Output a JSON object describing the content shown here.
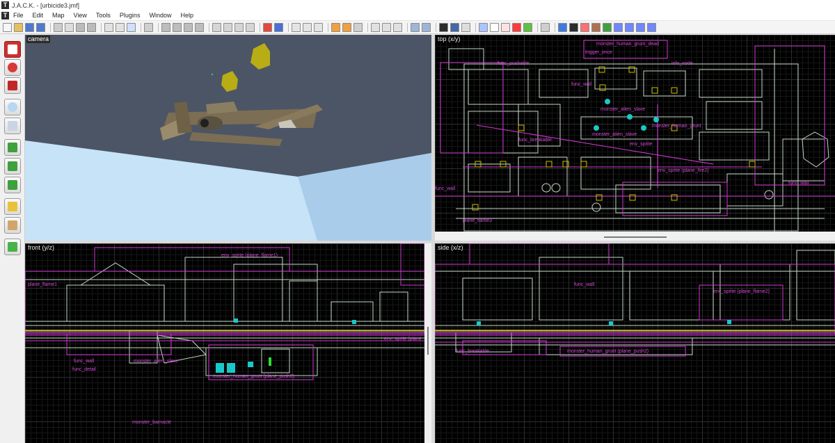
{
  "window": {
    "title": "J.A.C.K. - [urbicide3.jmf]"
  },
  "menu": {
    "items": [
      "File",
      "Edit",
      "Map",
      "View",
      "Tools",
      "Plugins",
      "Window",
      "Help"
    ]
  },
  "viewports": {
    "camera": {
      "label": "camera"
    },
    "top": {
      "label": "top (x/y)"
    },
    "front": {
      "label": "front (y/z)"
    },
    "side": {
      "label": "side (x/z)"
    }
  },
  "entity_labels": {
    "top": [
      "monster_human_grunt_dead",
      "trigger_once",
      "func_wall",
      "func_pushable",
      "info_node",
      "monster_alien_slave",
      "env_sprite",
      "monster_human_grunt",
      "monster_alien_slave",
      "func_breakable",
      "func_wall",
      "env_sprite (plane_fire2)",
      "plane_flame3",
      "func_wall"
    ],
    "front": [
      "env_sprite (plane_flame1)",
      "plane_flame1",
      "func_wall",
      "func_detail",
      "monster_alien_slave",
      "monster_human_grunt (plane_push2)",
      "monster_barnacle",
      "env_sprite (plane"
    ],
    "side": [
      "env_sprite (plane_flame2)",
      "func_wall",
      "monster_human_grunt (plane_push2)",
      "func_breakable"
    ]
  },
  "colors": {
    "sky": "#4c5565",
    "ground": "#c6e3f7",
    "entity_text": "#d54ad6",
    "brush_white": "#e6ffe9",
    "entity_magenta": "#d43ad6",
    "entity_yellow": "#ccc000",
    "entity_cyan": "#19c9c9",
    "grid_background": "#000000"
  }
}
